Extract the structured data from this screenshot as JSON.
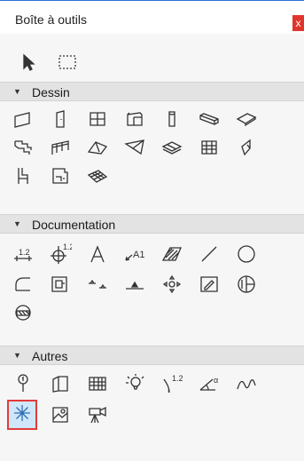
{
  "window": {
    "title": "Boîte à outils",
    "close_label": "x"
  },
  "sections": {
    "dessin": "Dessin",
    "documentation": "Documentation",
    "autres": "Autres"
  },
  "tools": {
    "top": [
      "arrow",
      "marquee"
    ],
    "dessin": [
      "wall",
      "door",
      "window",
      "column",
      "beam",
      "slab",
      "stair",
      "railing",
      "roof",
      "shell",
      "skylight",
      "curtain-wall",
      "morph",
      "object",
      "zone",
      "mesh"
    ],
    "documentation": [
      "dimension",
      "level-dimension",
      "text",
      "label",
      "fill",
      "line",
      "circle",
      "arc",
      "polyline",
      "spline",
      "hotspot",
      "drawing",
      "figure",
      "section-marker"
    ],
    "autres": [
      "marker",
      "door-frame",
      "grid",
      "lamp",
      "angle-dimension",
      "radial-dimension",
      "curve",
      "sun",
      "photo",
      "camera"
    ]
  },
  "selected_tool": "sun"
}
